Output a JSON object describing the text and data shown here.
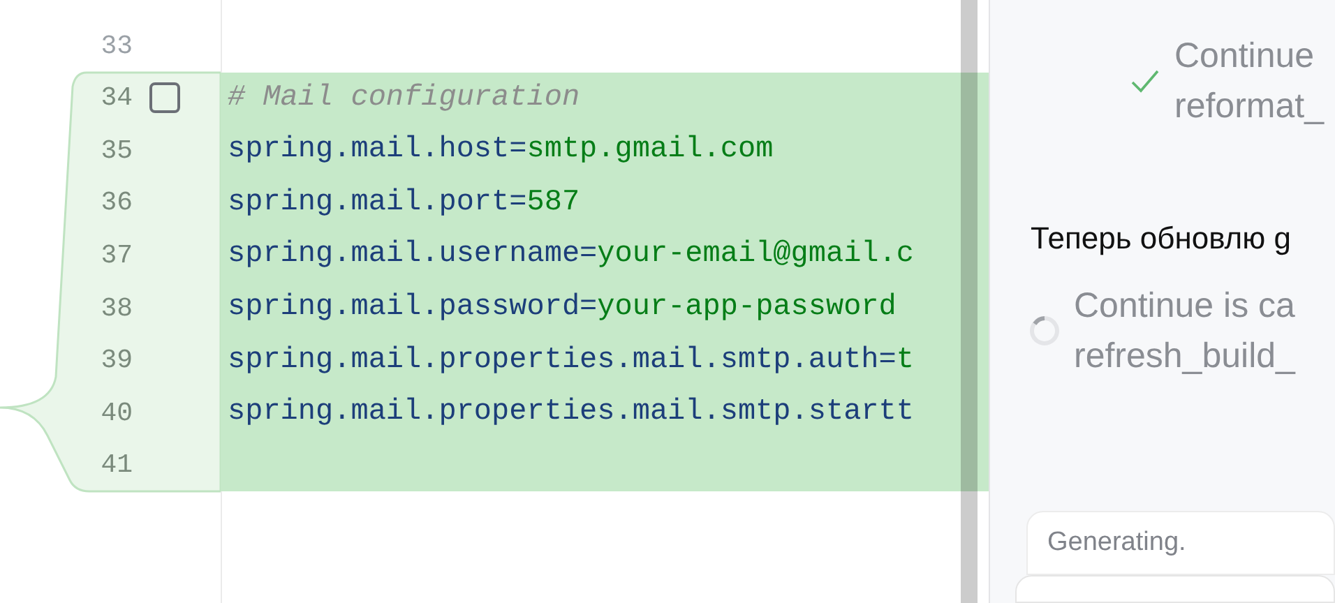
{
  "editor": {
    "lines": [
      {
        "number": "33",
        "kind": "blank",
        "changed": false
      },
      {
        "number": "34",
        "kind": "comment",
        "changed": true,
        "text": "# Mail configuration",
        "checkbox": {
          "checked": false
        }
      },
      {
        "number": "35",
        "kind": "property",
        "changed": true,
        "key": "spring.mail.host=",
        "value": "smtp.gmail.com"
      },
      {
        "number": "36",
        "kind": "property",
        "changed": true,
        "key": "spring.mail.port=",
        "value": "587"
      },
      {
        "number": "37",
        "kind": "property",
        "changed": true,
        "key": "spring.mail.username=",
        "value": "your-email@gmail.c"
      },
      {
        "number": "38",
        "kind": "property",
        "changed": true,
        "key": "spring.mail.password=",
        "value": "your-app-password"
      },
      {
        "number": "39",
        "kind": "property",
        "changed": true,
        "key": "spring.mail.properties.mail.smtp.auth=",
        "value": "t"
      },
      {
        "number": "40",
        "kind": "property",
        "changed": true,
        "key": "spring.mail.properties.mail.smtp.startt"
      },
      {
        "number": "41",
        "kind": "blank",
        "changed": true
      }
    ]
  },
  "chat": {
    "items": [
      {
        "kind": "tool",
        "done": true,
        "lines": [
          "Continue",
          "reformat_"
        ]
      },
      {
        "kind": "message",
        "text": "Теперь обновлю g"
      },
      {
        "kind": "tool",
        "done": false,
        "lines": [
          "Continue is ca",
          "refresh_build_"
        ]
      }
    ],
    "input": {
      "placeholder": "Generating."
    }
  }
}
